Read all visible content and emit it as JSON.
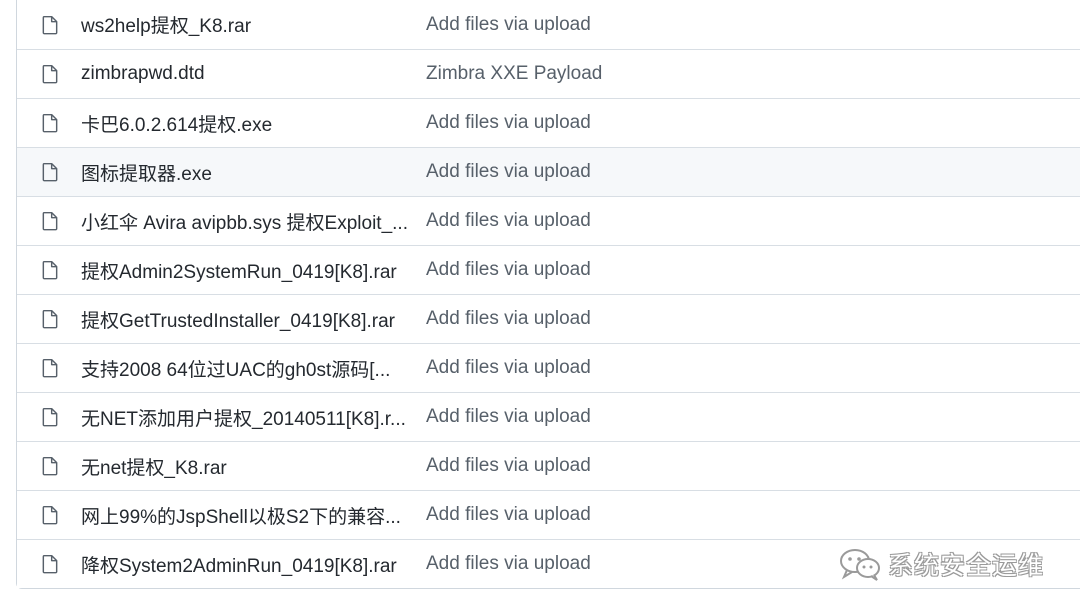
{
  "files": [
    {
      "name": "ws2help提权_K8.rar",
      "message": "Add files via upload",
      "icon": "file-icon"
    },
    {
      "name": "zimbrapwd.dtd",
      "message": "Zimbra XXE Payload",
      "icon": "file-icon"
    },
    {
      "name": "卡巴6.0.2.614提权.exe",
      "message": "Add files via upload",
      "icon": "file-icon"
    },
    {
      "name": "图标提取器.exe",
      "message": "Add files via upload",
      "icon": "file-icon"
    },
    {
      "name": "小红伞 Avira avipbb.sys 提权Exploit_...",
      "message": "Add files via upload",
      "icon": "file-icon"
    },
    {
      "name": "提权Admin2SystemRun_0419[K8].rar",
      "message": "Add files via upload",
      "icon": "file-icon"
    },
    {
      "name": "提权GetTrustedInstaller_0419[K8].rar",
      "message": "Add files via upload",
      "icon": "file-icon"
    },
    {
      "name": "支持2008 64位过UAC的gh0st源码[...",
      "message": "Add files via upload",
      "icon": "file-icon"
    },
    {
      "name": "无NET添加用户提权_20140511[K8].r...",
      "message": "Add files via upload",
      "icon": "file-icon"
    },
    {
      "name": "无net提权_K8.rar",
      "message": "Add files via upload",
      "icon": "file-icon"
    },
    {
      "name": "网上99%的JspShell以极S2下的兼容...",
      "message": "Add files via upload",
      "icon": "file-icon"
    },
    {
      "name": "降权System2AdminRun_0419[K8].rar",
      "message": "Add files via upload",
      "icon": "file-icon"
    }
  ],
  "watermark": {
    "text": "系统安全运维",
    "icon": "wechat-icon"
  }
}
